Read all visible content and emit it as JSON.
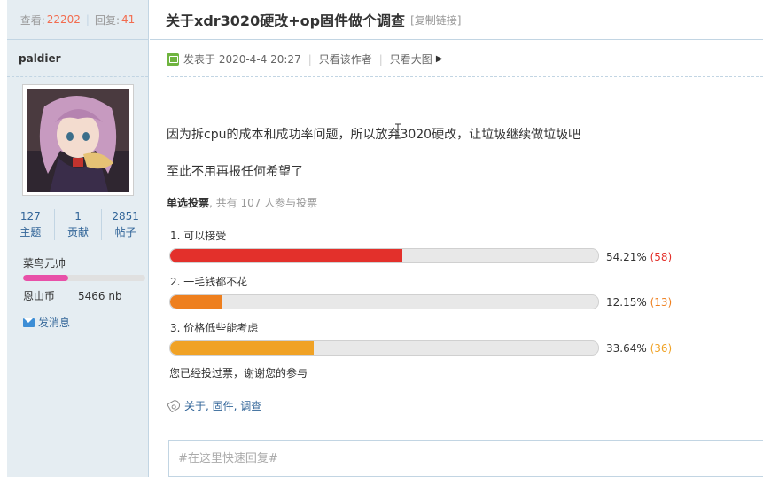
{
  "sidebar": {
    "views_label": "查看:",
    "views": "22202",
    "replies_label": "回复:",
    "replies": "41",
    "author": "paldier",
    "stats": [
      {
        "value": "127",
        "label": "主题"
      },
      {
        "value": "1",
        "label": "贡献"
      },
      {
        "value": "2851",
        "label": "帖子"
      }
    ],
    "rank": "菜鸟元帅",
    "rank_progress": 0.37,
    "coin_label": "恩山币",
    "coin_value": "5466 nb",
    "message_link": "发消息"
  },
  "post": {
    "title": "关于xdr3020硬改+op固件做个调查",
    "copy_link": "[复制链接]",
    "posted": "发表于 2020-4-4 20:27",
    "only_author": "只看该作者",
    "only_large": "只看大图",
    "paragraph1": "因为拆cpu的成本和成功率问题，所以放弃3020硬改，让垃圾继续做垃圾吧",
    "paragraph2": "至此不用再报任何希望了",
    "poll_type": "单选投票",
    "poll_count": ", 共有 107 人参与投票",
    "options": [
      {
        "label": "1.  可以接受",
        "percent_text": "54.21%",
        "count": "(58)",
        "fraction": 0.5421,
        "color": "#e3302b"
      },
      {
        "label": "2.  一毛钱都不花",
        "percent_text": "12.15%",
        "count": "(13)",
        "fraction": 0.1215,
        "color": "#ee7f1e"
      },
      {
        "label": "3.  价格低些能考虑",
        "percent_text": "33.64%",
        "count": "(36)",
        "fraction": 0.3364,
        "color": "#f0a225"
      }
    ],
    "voted_text": "您已经投过票，谢谢您的参与",
    "tags": "关于, 固件, 调查",
    "reply_placeholder": "#在这里快速回复#"
  }
}
